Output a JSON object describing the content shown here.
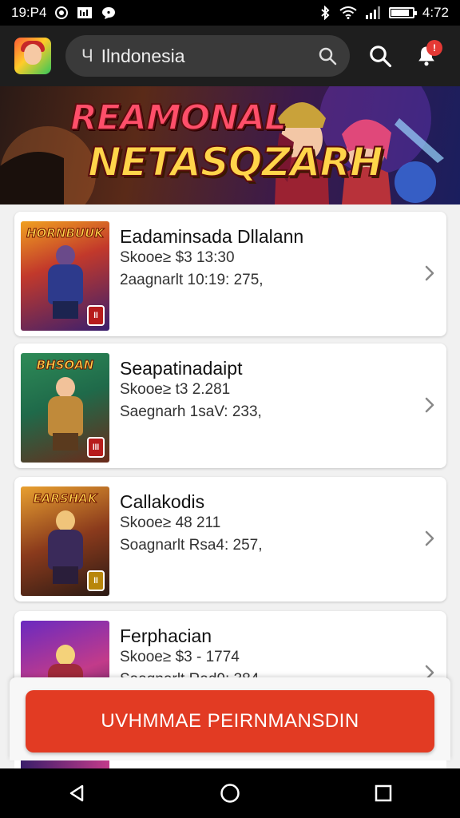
{
  "status_bar": {
    "time": "19:P4",
    "right_text": "4:72",
    "icons": [
      "record-icon",
      "gallery-icon",
      "chat-icon",
      "bluetooth-icon",
      "wifi-icon",
      "signal-icon",
      "battery-icon"
    ],
    "battery_level": 0.85
  },
  "header": {
    "logo_icon": "app-logo-icon",
    "search": {
      "region_glyph": "Ч",
      "value": "Ilndonesia",
      "icon": "search-icon"
    },
    "search_button_icon": "search-icon",
    "notification_icon": "bell-icon",
    "notification_badge": "!"
  },
  "banner": {
    "line1": "REAMONAL",
    "line2": "NETASQZARH"
  },
  "cards": [
    {
      "title": "Eadaminsada Dllalann",
      "line1": "Skooe≥ $3   13:30",
      "line2": "2aagnarlt   10:19: 275,",
      "thumb_title": "HORNBUUK",
      "badge": "ll"
    },
    {
      "title": "Seapatinadaipt",
      "line1": "Skooe≥ t3    2.281",
      "line2": "Saegnarh   1saV: 233,",
      "thumb_title": "BHSOAN",
      "badge": "lll"
    },
    {
      "title": "Callakodis",
      "line1": "Skooe≥ 48    211",
      "line2": "Soagnarlt   Rsa4: 257,",
      "thumb_title": "EARSHAK",
      "badge": "ll"
    },
    {
      "title": "Ferphacian",
      "line1": "Skooe≥ $3 - 1774",
      "line2": "Saagnarlt   Rad9: 384,",
      "thumb_title": "",
      "badge": ""
    }
  ],
  "cta": {
    "label": "UVHMMAE PEIRNMANSDIN"
  },
  "colors": {
    "accent": "#e23b23",
    "header_bg": "#1e1e1e",
    "badge": "#e53935"
  },
  "nav_bar": {
    "icons": [
      "back-icon",
      "home-icon",
      "recents-icon"
    ]
  }
}
